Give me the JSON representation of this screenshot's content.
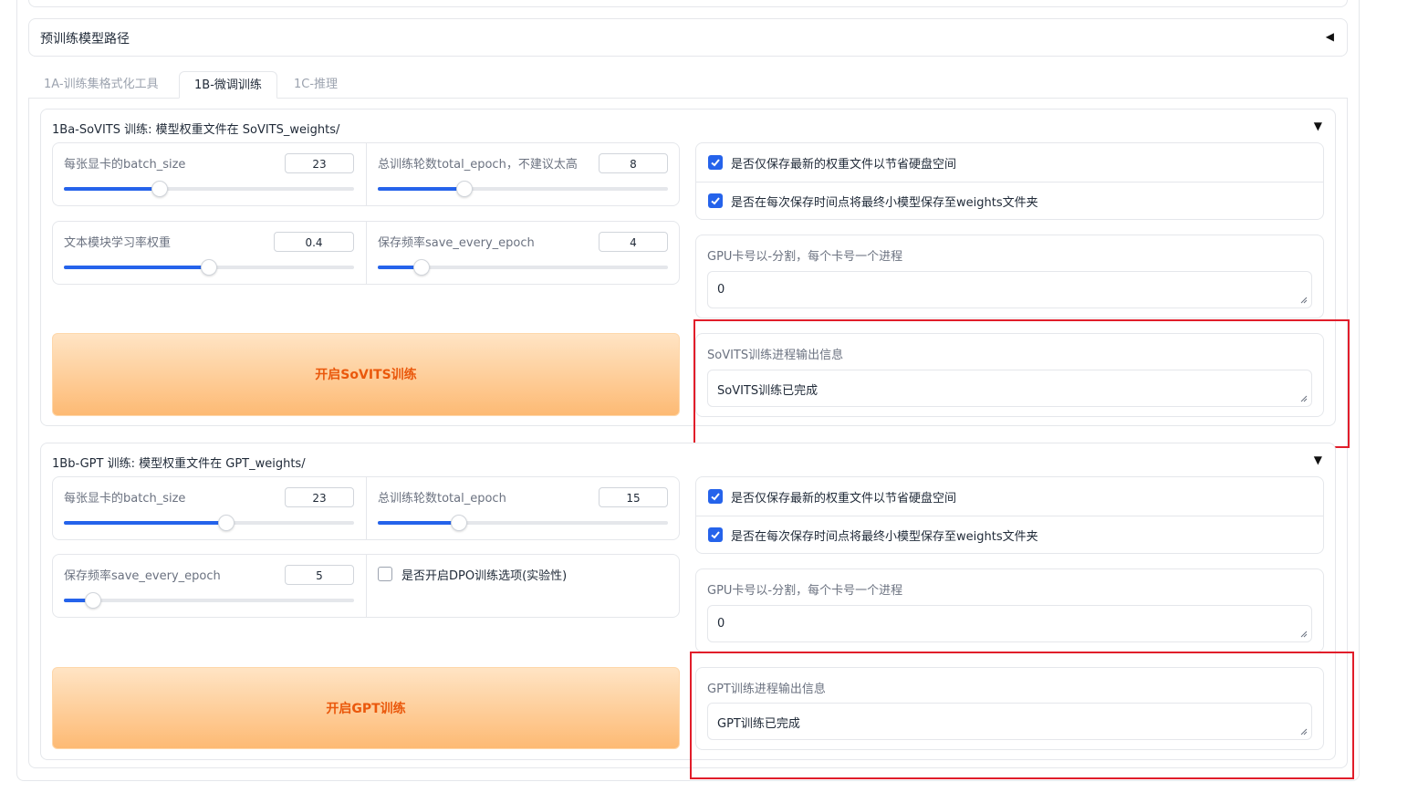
{
  "pretrained_section": {
    "title": "预训练模型路径",
    "arrow": "◀"
  },
  "tabs": [
    {
      "label": "1A-训练集格式化工具",
      "active": false
    },
    {
      "label": "1B-微调训练",
      "active": true
    },
    {
      "label": "1C-推理",
      "active": false
    }
  ],
  "sovits": {
    "title": "1Ba-SoVITS 训练: 模型权重文件在 SoVITS_weights/",
    "arrow": "▼",
    "sliders": {
      "batch_size": {
        "label": "每张显卡的batch_size",
        "value": "23",
        "fraction": 0.33
      },
      "total_epoch": {
        "label": "总训练轮数total_epoch，不建议太高",
        "value": "8",
        "fraction": 0.3
      },
      "text_lr": {
        "label": "文本模块学习率权重",
        "value": "0.4",
        "fraction": 0.5
      },
      "save_every": {
        "label": "保存频率save_every_epoch",
        "value": "4",
        "fraction": 0.15
      }
    },
    "start_button": "开启SoVITS训练",
    "checkboxes": [
      {
        "label": "是否仅保存最新的权重文件以节省硬盘空间",
        "checked": true
      },
      {
        "label": "是否在每次保存时间点将最终小模型保存至weights文件夹",
        "checked": true
      }
    ],
    "gpu": {
      "label": "GPU卡号以-分割，每个卡号一个进程",
      "value": "0"
    },
    "output": {
      "label": "SoVITS训练进程输出信息",
      "value": "SoVITS训练已完成"
    }
  },
  "gpt": {
    "title": "1Bb-GPT 训练: 模型权重文件在 GPT_weights/",
    "arrow": "▼",
    "sliders": {
      "batch_size": {
        "label": "每张显卡的batch_size",
        "value": "23",
        "fraction": 0.56
      },
      "total_epoch": {
        "label": "总训练轮数total_epoch",
        "value": "15",
        "fraction": 0.28
      },
      "save_every": {
        "label": "保存频率save_every_epoch",
        "value": "5",
        "fraction": 0.1
      }
    },
    "dpo": {
      "label": "是否开启DPO训练选项(实验性)",
      "checked": false
    },
    "start_button": "开启GPT训练",
    "checkboxes": [
      {
        "label": "是否仅保存最新的权重文件以节省硬盘空间",
        "checked": true
      },
      {
        "label": "是否在每次保存时间点将最终小模型保存至weights文件夹",
        "checked": true
      }
    ],
    "gpu": {
      "label": "GPU卡号以-分割，每个卡号一个进程",
      "value": "0"
    },
    "output": {
      "label": "GPT训练进程输出信息",
      "value": "GPT训练已完成"
    }
  },
  "colors": {
    "accent": "#2563eb",
    "button_text": "#ea580c",
    "highlight": "#e11d2a"
  }
}
